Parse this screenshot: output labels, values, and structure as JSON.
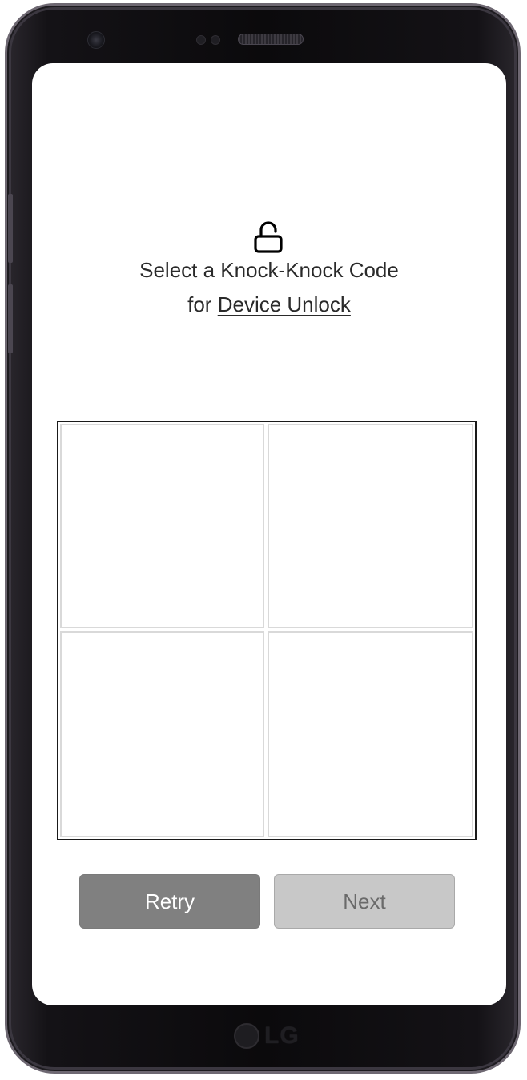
{
  "device": {
    "brand_logo_text": "LG"
  },
  "screen": {
    "icon": "unlocked-padlock-icon",
    "title_line1": "Select a Knock-Knock Code",
    "title_line2_prefix": "for ",
    "title_line2_link": "Device Unlock"
  },
  "knock_grid": {
    "cells": [
      "top-left",
      "top-right",
      "bottom-left",
      "bottom-right"
    ]
  },
  "buttons": {
    "retry_label": "Retry",
    "next_label": "Next"
  },
  "colors": {
    "retry_bg": "#808080",
    "next_bg": "#c8c8c8",
    "frame": "#0b0a0c"
  }
}
